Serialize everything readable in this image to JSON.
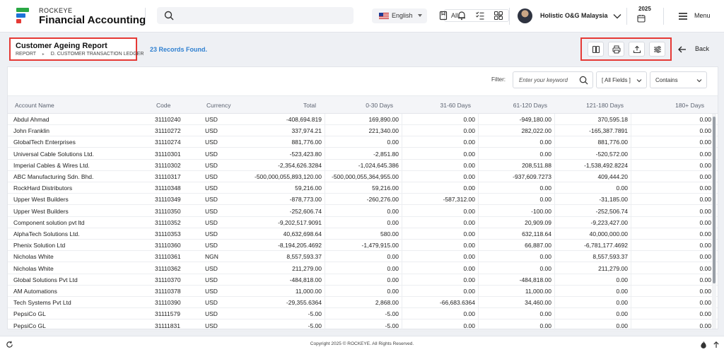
{
  "header": {
    "brand_top": "ROCKEYE",
    "brand_main": "Financial Accounting",
    "search_scope": "All",
    "language": "English",
    "company": "Holistic O&G Malaysia",
    "year": "2025",
    "menu_label": "Menu",
    "colors": {
      "brand_green": "#2aa845",
      "brand_blue": "#1e73d8",
      "brand_red": "#e53935"
    }
  },
  "subheader": {
    "title": "Customer Ageing Report",
    "breadcrumb": [
      "REPORT",
      "D. CUSTOMER TRANSACTION LEDGER"
    ],
    "breadcrumb_sep": "►",
    "records": "23 Records Found.",
    "back_label": "Back",
    "tools": [
      "columns-icon",
      "print-icon",
      "export-icon",
      "settings-sliders-icon"
    ]
  },
  "filter": {
    "label": "Filter:",
    "keyword_placeholder": "Enter your keyword",
    "field": "[ All Fields ]",
    "operator": "Contains"
  },
  "table": {
    "columns": [
      "Account Name",
      "Code",
      "Currency",
      "Total",
      "0-30 Days",
      "31-60 Days",
      "61-120 Days",
      "121-180 Days",
      "180+ Days"
    ],
    "rows": [
      [
        "Abdul Ahmad",
        "31110240",
        "USD",
        "-408,694.819",
        "169,890.00",
        "0.00",
        "-949,180.00",
        "370,595.18",
        "0.00"
      ],
      [
        "John Franklin",
        "31110272",
        "USD",
        "337,974.21",
        "221,340.00",
        "0.00",
        "282,022.00",
        "-165,387.7891",
        "0.00"
      ],
      [
        "GlobalTech Enterprises",
        "31110274",
        "USD",
        "881,776.00",
        "0.00",
        "0.00",
        "0.00",
        "881,776.00",
        "0.00"
      ],
      [
        "Universal Cable Solutions Ltd.",
        "31110301",
        "USD",
        "-523,423.80",
        "-2,851.80",
        "0.00",
        "0.00",
        "-520,572.00",
        "0.00"
      ],
      [
        "Imperial Cables & Wires Ltd.",
        "31110302",
        "USD",
        "-2,354,626.3284",
        "-1,024,645.386",
        "0.00",
        "208,511.88",
        "-1,538,492.8224",
        "0.00"
      ],
      [
        "ABC Manufacturing Sdn. Bhd.",
        "31110317",
        "USD",
        "-500,000,055,893,120.00",
        "-500,000,055,364,955.00",
        "0.00",
        "-937,609.7273",
        "409,444.20",
        "0.00"
      ],
      [
        "RockHard Distributors",
        "31110348",
        "USD",
        "59,216.00",
        "59,216.00",
        "0.00",
        "0.00",
        "0.00",
        "0.00"
      ],
      [
        "Upper West Builders",
        "31110349",
        "USD",
        "-878,773.00",
        "-260,276.00",
        "-587,312.00",
        "0.00",
        "-31,185.00",
        "0.00"
      ],
      [
        "Upper West Builders",
        "31110350",
        "USD",
        "-252,606.74",
        "0.00",
        "0.00",
        "-100.00",
        "-252,506.74",
        "0.00"
      ],
      [
        "Component solution pvt ltd",
        "31110352",
        "USD",
        "-9,202,517.9091",
        "0.00",
        "0.00",
        "20,909.09",
        "-9,223,427.00",
        "0.00"
      ],
      [
        "AlphaTech Solutions Ltd.",
        "31110353",
        "USD",
        "40,632,698.64",
        "580.00",
        "0.00",
        "632,118.64",
        "40,000,000.00",
        "0.00"
      ],
      [
        "Phenix Solution Ltd",
        "31110360",
        "USD",
        "-8,194,205.4692",
        "-1,479,915.00",
        "0.00",
        "66,887.00",
        "-6,781,177.4692",
        "0.00"
      ],
      [
        "Nicholas White",
        "31110361",
        "NGN",
        "8,557,593.37",
        "0.00",
        "0.00",
        "0.00",
        "8,557,593.37",
        "0.00"
      ],
      [
        "Nicholas White",
        "31110362",
        "USD",
        "211,279.00",
        "0.00",
        "0.00",
        "0.00",
        "211,279.00",
        "0.00"
      ],
      [
        "Global Solutions Pvt Ltd",
        "31110370",
        "USD",
        "-484,818.00",
        "0.00",
        "0.00",
        "-484,818.00",
        "0.00",
        "0.00"
      ],
      [
        "AM Automations",
        "31110378",
        "USD",
        "11,000.00",
        "0.00",
        "0.00",
        "11,000.00",
        "0.00",
        "0.00"
      ],
      [
        "Tech Systems Pvt Ltd",
        "31110390",
        "USD",
        "-29,355.6364",
        "2,868.00",
        "-66,683.6364",
        "34,460.00",
        "0.00",
        "0.00"
      ],
      [
        "PepsiCo GL",
        "31111579",
        "USD",
        "-5.00",
        "-5.00",
        "0.00",
        "0.00",
        "0.00",
        "0.00"
      ],
      [
        "PepsiCo GL",
        "31111831",
        "USD",
        "-5.00",
        "-5.00",
        "0.00",
        "0.00",
        "0.00",
        "0.00"
      ]
    ]
  },
  "footer": {
    "copyright": "Copyright 2025 © ROCKEYE. All Rights Reserved."
  }
}
